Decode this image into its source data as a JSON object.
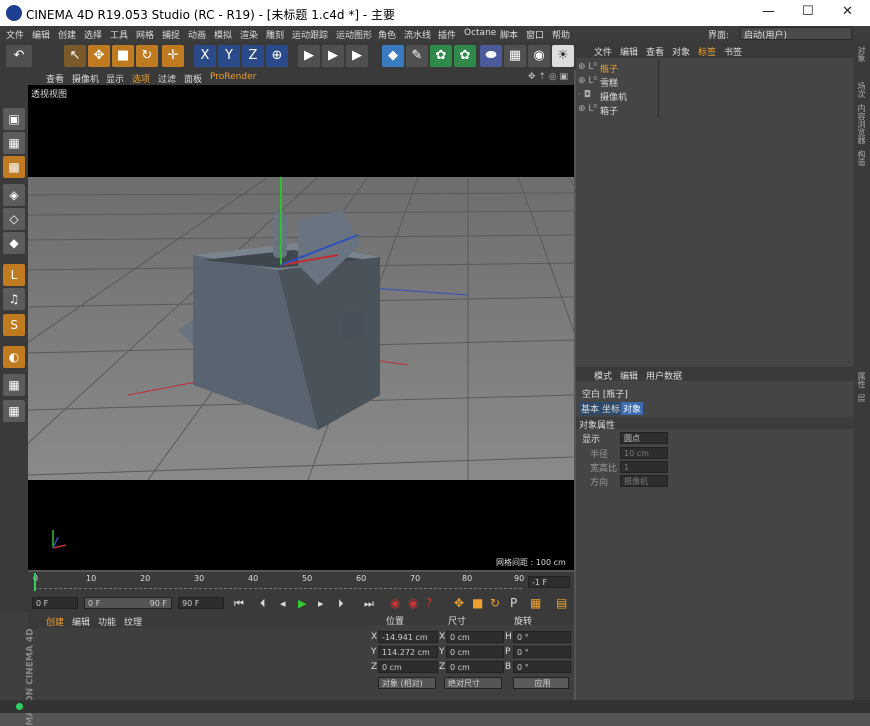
{
  "titlebar": {
    "title": "CINEMA 4D R19.053 Studio (RC - R19) - [未标题 1.c4d *] - 主要",
    "minimize": "—",
    "maximize": "☐",
    "close": "✕"
  },
  "menubar": {
    "items": [
      "文件",
      "编辑",
      "创建",
      "选择",
      "工具",
      "网格",
      "捕捉",
      "动画",
      "模拟",
      "渲染",
      "雕刻",
      "运动跟踪",
      "运动图形",
      "角色",
      "流水线",
      "插件",
      "Octane",
      "脚本",
      "窗口",
      "帮助"
    ],
    "layout_label": "界面:",
    "layout_value": "启动(用户)"
  },
  "toolbar": {
    "buttons": [
      "↶",
      "↖",
      "✥",
      "■",
      "↻",
      "✛",
      "X",
      "Y",
      "Z",
      "⊕",
      "▶",
      "▶",
      "▶",
      "◆",
      "✎",
      "✿",
      "✿",
      "⬬",
      "▦",
      "◉",
      "☀"
    ]
  },
  "lefttools": [
    "▣",
    "▦",
    "▩",
    "◈",
    "◇",
    "◆",
    "L",
    "♫",
    "S",
    "◐",
    "▦",
    "▦"
  ],
  "viewport": {
    "menu": [
      "查看",
      "摄像机",
      "显示",
      "选项",
      "过滤",
      "面板",
      "ProRender"
    ],
    "label": "透视视图",
    "grid_spacing": "网格间距 : 100 cm"
  },
  "objects": {
    "menu": [
      "文件",
      "编辑",
      "查看",
      "对象",
      "标签",
      "书签"
    ],
    "items": [
      "瓶子",
      "雪糕",
      "摄像机",
      "箱子"
    ]
  },
  "attributes": {
    "menu": [
      "模式",
      "编辑",
      "用户数据"
    ],
    "title": "空白 [瓶子]",
    "tabs": [
      "基本",
      "坐标",
      "对象"
    ],
    "section": "对象属性",
    "props": [
      {
        "label": "显示",
        "value": "圆点"
      },
      {
        "label": "半径",
        "value": "10 cm"
      },
      {
        "label": "宽高比",
        "value": "1"
      },
      {
        "label": "方向",
        "value": "摄像机"
      }
    ]
  },
  "sidetabs": [
    "对象",
    "场次",
    "内容浏览器",
    "构造",
    "属性",
    "层"
  ],
  "timeline": {
    "ticks": [
      "0",
      "10",
      "20",
      "30",
      "40",
      "50",
      "60",
      "70",
      "80",
      "90"
    ],
    "current": "-1 F"
  },
  "timectrl": {
    "start": "0 F",
    "range": "0 F",
    "range_end": "90 F",
    "end": "90 F"
  },
  "materials": {
    "menu": [
      "创建",
      "编辑",
      "功能",
      "纹理"
    ],
    "brand": "MAXON CINEMA 4D"
  },
  "coords": {
    "headers": [
      "位置",
      "尺寸",
      "旋转"
    ],
    "rows": [
      {
        "axis": "X",
        "pos": "-14.941 cm",
        "sizeaxis": "X",
        "size": "0 cm",
        "rotaxis": "H",
        "rot": "0 °"
      },
      {
        "axis": "Y",
        "pos": "114.272 cm",
        "sizeaxis": "Y",
        "size": "0 cm",
        "rotaxis": "P",
        "rot": "0 °"
      },
      {
        "axis": "Z",
        "pos": "0 cm",
        "sizeaxis": "Z",
        "size": "0 cm",
        "rotaxis": "B",
        "rot": "0 °"
      }
    ],
    "mode": "对象 (相对)",
    "sizemode": "绝对尺寸",
    "apply": "应用"
  },
  "colors": {
    "accent": "#f0a030",
    "viewport_bg": "#000000",
    "floor": "#7a7a7a",
    "object": "#5c6670"
  }
}
